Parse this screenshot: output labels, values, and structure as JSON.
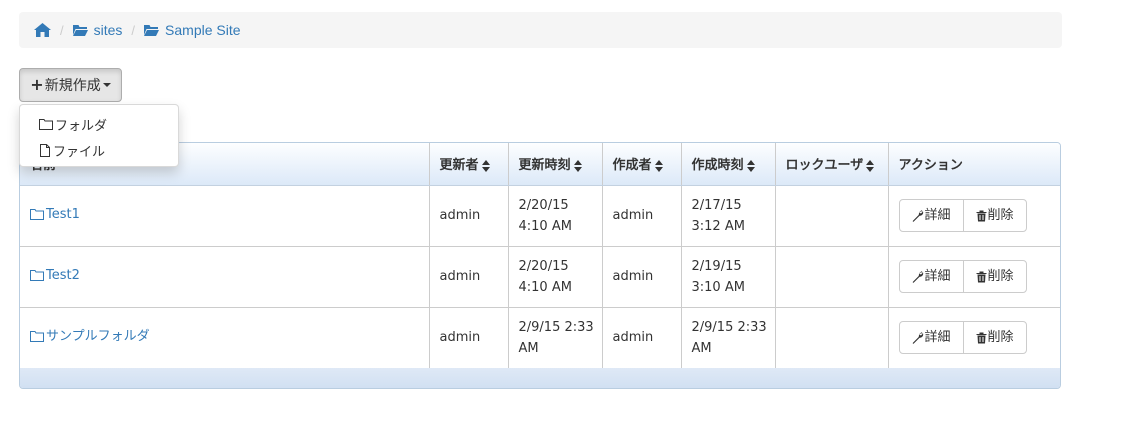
{
  "breadcrumb": {
    "home_icon": "home-icon",
    "items": [
      {
        "label": "sites",
        "icon": "folder-open-icon"
      },
      {
        "label": "Sample Site",
        "icon": "folder-open-icon"
      }
    ],
    "separator": "/"
  },
  "toolbar": {
    "new_label": "新規作成",
    "new_plus": "+"
  },
  "dropdown": {
    "items": [
      {
        "label": "フォルダ",
        "icon": "folder-icon"
      },
      {
        "label": "ファイル",
        "icon": "file-icon"
      }
    ]
  },
  "table": {
    "columns": [
      "名前",
      "更新者",
      "更新時刻",
      "作成者",
      "作成時刻",
      "ロックユーザ",
      "アクション"
    ],
    "rows": [
      {
        "name": "Test1",
        "updated_by": "admin",
        "updated_at": "2/20/15 4:10 AM",
        "created_by": "admin",
        "created_at": "2/17/15 3:12 AM",
        "lock_user": ""
      },
      {
        "name": "Test2",
        "updated_by": "admin",
        "updated_at": "2/20/15 4:10 AM",
        "created_by": "admin",
        "created_at": "2/19/15 3:10 AM",
        "lock_user": ""
      },
      {
        "name": "サンプルフォルダ",
        "updated_by": "admin",
        "updated_at": "2/9/15 2:33 AM",
        "created_by": "admin",
        "created_at": "2/9/15 2:33 AM",
        "lock_user": ""
      }
    ],
    "actions": {
      "detail_label": "詳細",
      "delete_label": "削除"
    }
  },
  "colors": {
    "link": "#337ab7",
    "breadcrumb_bg": "#f5f5f5",
    "header_gradient_top": "#fdfeff",
    "header_gradient_bottom": "#dce9f8",
    "panel_border": "#b9cde0"
  }
}
